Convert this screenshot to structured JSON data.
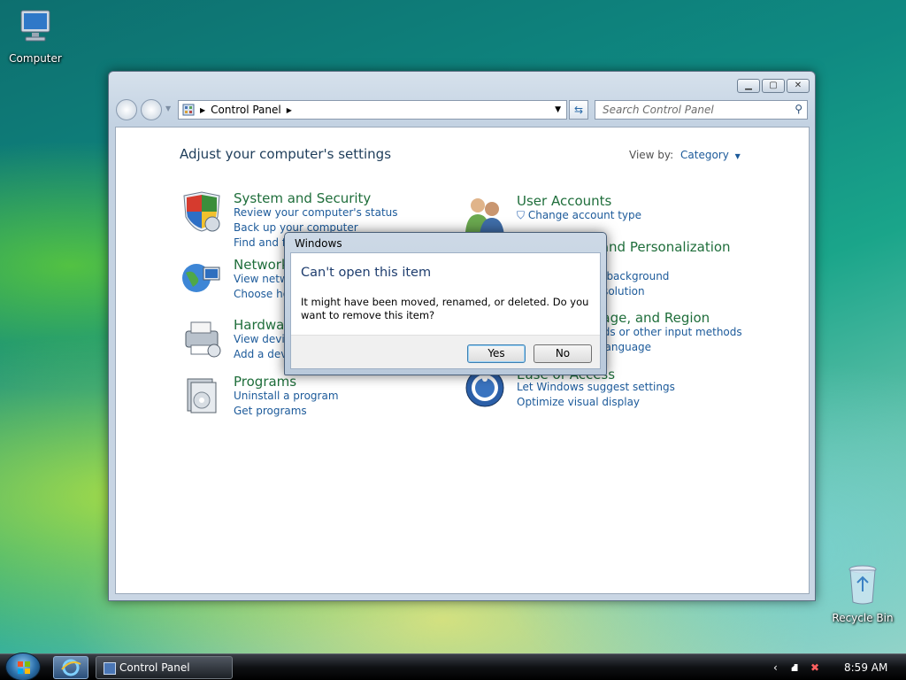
{
  "desktop": {
    "computer_label": "Computer",
    "recycle_label": "Recycle Bin"
  },
  "window": {
    "address_crumb": "Control Panel",
    "search_placeholder": "Search Control Panel",
    "heading": "Adjust your computer's settings",
    "view_by_label": "View by:",
    "view_by_value": "Category",
    "categories": [
      {
        "title": "System and Security",
        "links": [
          "Review your computer's status",
          "Back up your computer",
          "Find and fix problems"
        ]
      },
      {
        "title": "User Accounts",
        "links": [
          "Change account type"
        ]
      },
      {
        "title": "Network and Internet",
        "links": [
          "View network status and tasks",
          "Choose homegroup and sharing options"
        ]
      },
      {
        "title": "Appearance and Personalization",
        "links": [
          "Change desktop background",
          "Adjust screen resolution"
        ]
      },
      {
        "title": "Hardware and Sound",
        "links": [
          "View devices and printers",
          "Add a device"
        ]
      },
      {
        "title": "Clock, Language, and Region",
        "links": [
          "Change keyboards or other input methods",
          "Change display language"
        ]
      },
      {
        "title": "Programs",
        "links": [
          "Uninstall a program",
          "Get programs"
        ]
      },
      {
        "title": "Ease of Access",
        "links": [
          "Let Windows suggest settings",
          "Optimize visual display"
        ]
      }
    ]
  },
  "dialog": {
    "title": "Windows",
    "heading": "Can't open this item",
    "message": "It might have been moved, renamed, or deleted. Do you want to remove this item?",
    "yes": "Yes",
    "no": "No"
  },
  "taskbar": {
    "task_label": "Control Panel",
    "clock": "8:59 AM"
  }
}
